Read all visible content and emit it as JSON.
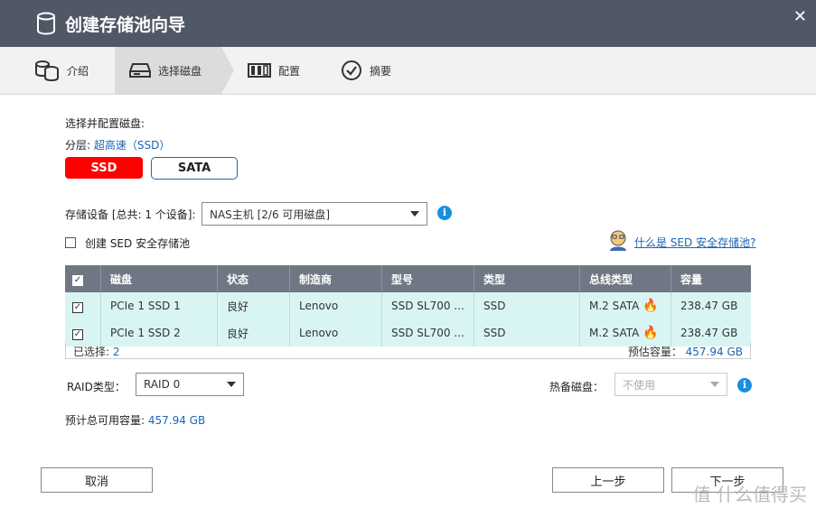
{
  "window": {
    "title": "创建存储池向导",
    "close_icon": "close-icon"
  },
  "steps": [
    {
      "label": "介绍"
    },
    {
      "label": "选择磁盘"
    },
    {
      "label": "配置"
    },
    {
      "label": "摘要"
    }
  ],
  "main": {
    "select_heading": "选择并配置磁盘:",
    "tier_prefix": "分层:",
    "tier_value": "超高速（SSD）",
    "tab_ssd": "SSD",
    "tab_sata": "SATA",
    "device_label": "存储设备 [总共: 1 个设备]:",
    "device_value": "NAS主机 [2/6 可用磁盘]",
    "sed_checkbox_label": "创建 SED 安全存储池",
    "sed_help_link": "什么是 SED 安全存储池?",
    "table": {
      "headers": [
        "磁盘",
        "状态",
        "制造商",
        "型号",
        "类型",
        "总线类型",
        "容量"
      ],
      "rows": [
        {
          "disk": "PCIe 1 SSD 1",
          "status": "良好",
          "vendor": "Lenovo",
          "model": "SSD SL700 ...",
          "type": "SSD",
          "bus": "M.2 SATA",
          "capacity": "238.47 GB"
        },
        {
          "disk": "PCIe 1 SSD 2",
          "status": "良好",
          "vendor": "Lenovo",
          "model": "SSD SL700 ...",
          "type": "SSD",
          "bus": "M.2 SATA",
          "capacity": "238.47 GB"
        }
      ],
      "selected_label": "已选择:",
      "selected_count": "2",
      "estimated_label": "预估容量：",
      "estimated_value": "457.94 GB"
    },
    "raid_label": "RAID类型：",
    "raid_value": "RAID 0",
    "hotspare_label": "热备磁盘：",
    "hotspare_value": "不使用",
    "total_label": "预计总可用容量:",
    "total_value": "457.94 GB"
  },
  "footer": {
    "cancel": "取消",
    "prev": "上一步",
    "next": "下一步"
  },
  "watermark": "值 什么值得买",
  "colors": {
    "titlebar": "#505766",
    "accent": "#1a66b3",
    "ssd_active": "#ff0000",
    "row_bg": "#d9f5f3",
    "header_bg": "#707784"
  }
}
